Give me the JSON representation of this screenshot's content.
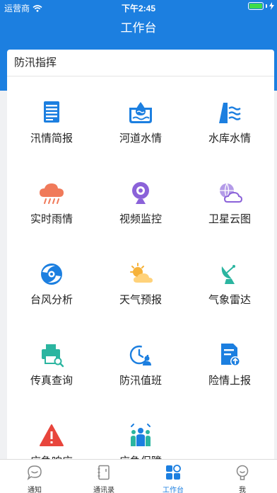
{
  "status_bar": {
    "carrier": "运营商",
    "time": "下午2:45"
  },
  "nav": {
    "title": "工作台"
  },
  "section": {
    "title": "防汛指挥",
    "items": [
      {
        "label": "汛情简报",
        "icon": "report-list-icon"
      },
      {
        "label": "河道水情",
        "icon": "river-water-icon"
      },
      {
        "label": "水库水情",
        "icon": "reservoir-water-icon"
      },
      {
        "label": "实时雨情",
        "icon": "rain-cloud-icon"
      },
      {
        "label": "视频监控",
        "icon": "webcam-icon"
      },
      {
        "label": "卫星云图",
        "icon": "satellite-cloud-icon"
      },
      {
        "label": "台风分析",
        "icon": "typhoon-icon"
      },
      {
        "label": "天气预报",
        "icon": "sun-cloud-icon"
      },
      {
        "label": "气象雷达",
        "icon": "radar-dish-icon"
      },
      {
        "label": "传真查询",
        "icon": "fax-search-icon"
      },
      {
        "label": "防汛值班",
        "icon": "duty-clock-icon"
      },
      {
        "label": "险情上报",
        "icon": "report-upload-icon"
      },
      {
        "label": "应急响应",
        "icon": "warning-triangle-icon"
      },
      {
        "label": "应急保障",
        "icon": "team-support-icon"
      }
    ]
  },
  "tabbar": {
    "tabs": [
      {
        "label": "通知",
        "icon": "chat-bubble-icon"
      },
      {
        "label": "通讯录",
        "icon": "contacts-book-icon"
      },
      {
        "label": "工作台",
        "icon": "grid-apps-icon",
        "active": true
      },
      {
        "label": "我",
        "icon": "person-icon"
      }
    ]
  },
  "colors": {
    "primary": "#1c7fe0",
    "active_tab": "#1c7fe0"
  }
}
